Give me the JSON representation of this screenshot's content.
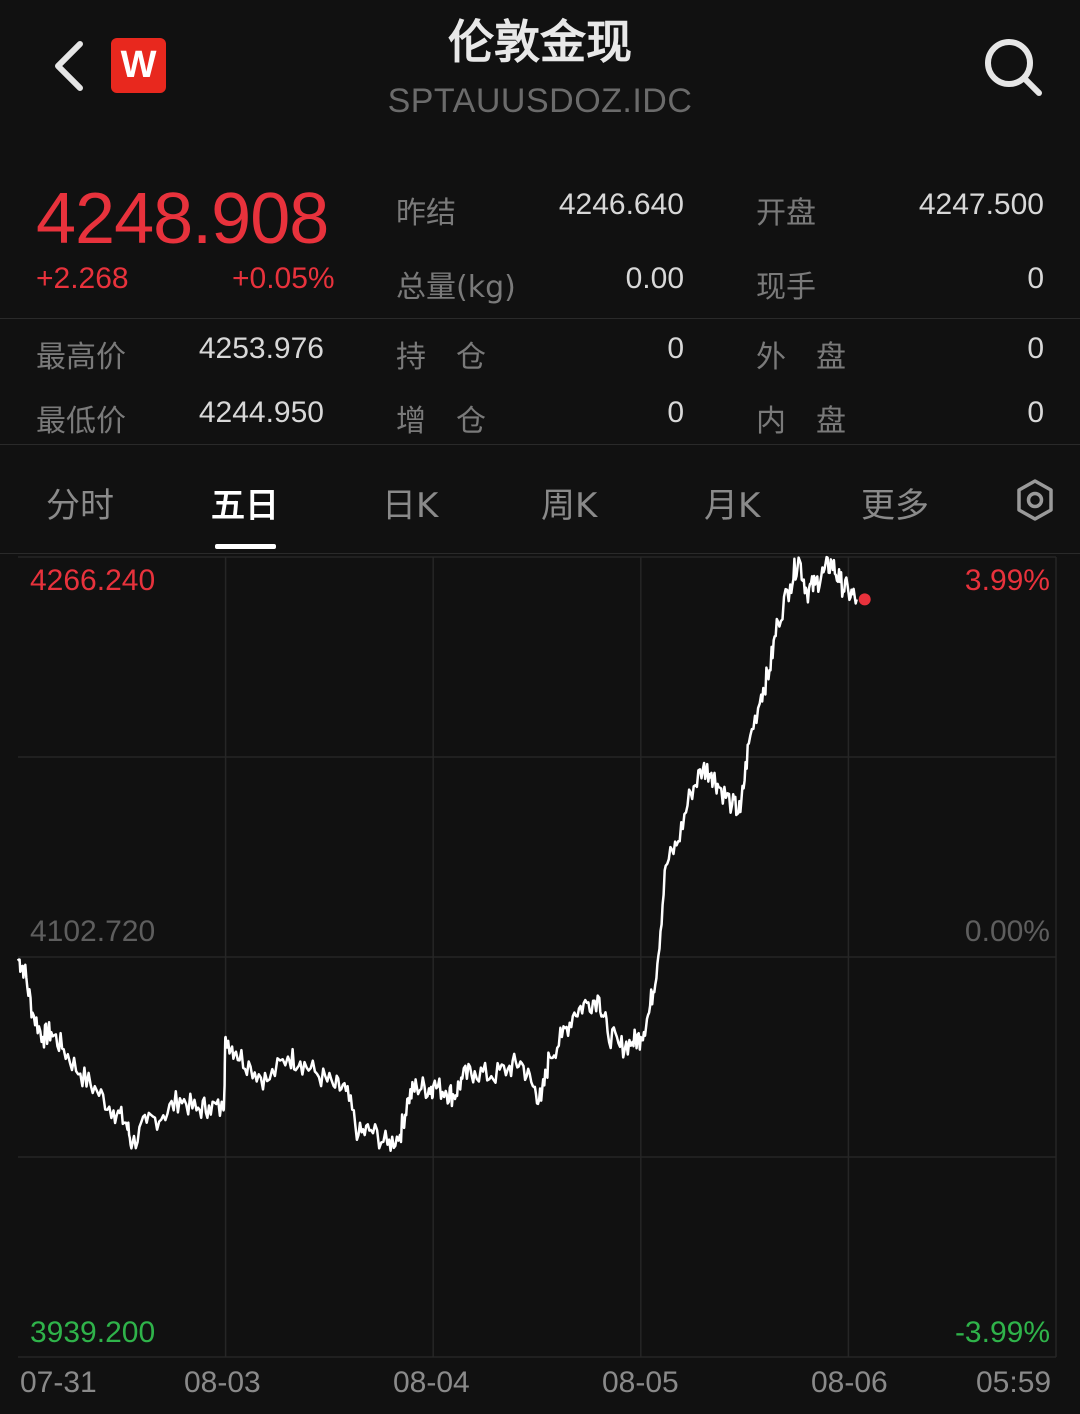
{
  "header": {
    "title": "伦敦金现",
    "symbol": "SPTAUUSDOZ.IDC",
    "logo_letter": "W",
    "back_icon": "chevron-left-icon",
    "search_icon": "search-icon"
  },
  "quote": {
    "price": "4248.908",
    "change": "+2.268",
    "change_pct": "+0.05%",
    "fields": {
      "prev_close_label": "昨结",
      "prev_close": "4246.640",
      "open_label": "开盘",
      "open": "4247.500",
      "volume_label": "总量(kg)",
      "volume": "0.00",
      "current_hand_label": "现手",
      "current_hand": "0",
      "high_label": "最高价",
      "high": "4253.976",
      "position_label": "持　仓",
      "position": "0",
      "outer_label": "外　盘",
      "outer": "0",
      "low_label": "最低价",
      "low": "4244.950",
      "increase_label": "增　仓",
      "increase": "0",
      "inner_label": "内　盘",
      "inner": "0"
    }
  },
  "tabs": [
    {
      "label": "分时",
      "active": false
    },
    {
      "label": "五日",
      "active": true
    },
    {
      "label": "日K",
      "active": false
    },
    {
      "label": "周K",
      "active": false
    },
    {
      "label": "月K",
      "active": false
    },
    {
      "label": "更多",
      "active": false
    }
  ],
  "colors": {
    "up": "#e8323c",
    "down": "#2fb34a",
    "line": "#ffffff",
    "grid": "#262626"
  },
  "chart_data": {
    "type": "line",
    "y_top_label": "4266.240",
    "y_mid_label": "4102.720",
    "y_bottom_label": "3939.200",
    "pct_top_label": "3.99%",
    "pct_mid_label": "0.00%",
    "pct_bottom_label": "-3.99%",
    "ylim": [
      3939.2,
      4266.24
    ],
    "x_labels": [
      "07-31",
      "08-03",
      "08-04",
      "08-05",
      "08-06",
      "05:59"
    ],
    "days": 5,
    "series": [
      {
        "values": [
          [
            0,
            4102
          ],
          [
            0.03,
            4098
          ],
          [
            0.07,
            4080
          ],
          [
            0.12,
            4070
          ],
          [
            0.16,
            4072
          ],
          [
            0.22,
            4065
          ],
          [
            0.3,
            4055
          ],
          [
            0.38,
            4048
          ],
          [
            0.46,
            4040
          ],
          [
            0.52,
            4035
          ],
          [
            0.55,
            4026
          ],
          [
            0.62,
            4035
          ],
          [
            0.7,
            4038
          ],
          [
            0.78,
            4045
          ],
          [
            0.86,
            4040
          ],
          [
            0.92,
            4042
          ],
          [
            0.99,
            4040
          ],
          [
            1.0,
            4070
          ],
          [
            1.05,
            4064
          ],
          [
            1.12,
            4058
          ],
          [
            1.2,
            4052
          ],
          [
            1.3,
            4062
          ],
          [
            1.36,
            4060
          ],
          [
            1.44,
            4055
          ],
          [
            1.52,
            4050
          ],
          [
            1.58,
            4048
          ],
          [
            1.64,
            4030
          ],
          [
            1.7,
            4032
          ],
          [
            1.78,
            4026
          ],
          [
            1.84,
            4030
          ],
          [
            1.88,
            4045
          ],
          [
            1.92,
            4050
          ],
          [
            1.98,
            4049
          ],
          [
            2.0,
            4050
          ],
          [
            2.06,
            4048
          ],
          [
            2.1,
            4046
          ],
          [
            2.14,
            4053
          ],
          [
            2.2,
            4056
          ],
          [
            2.28,
            4054
          ],
          [
            2.36,
            4057
          ],
          [
            2.42,
            4060
          ],
          [
            2.48,
            4050
          ],
          [
            2.52,
            4044
          ],
          [
            2.56,
            4062
          ],
          [
            2.62,
            4070
          ],
          [
            2.68,
            4080
          ],
          [
            2.74,
            4084
          ],
          [
            2.8,
            4086
          ],
          [
            2.84,
            4072
          ],
          [
            2.9,
            4066
          ],
          [
            2.96,
            4068
          ],
          [
            3.0,
            4070
          ],
          [
            3.04,
            4080
          ],
          [
            3.08,
            4100
          ],
          [
            3.12,
            4140
          ],
          [
            3.18,
            4150
          ],
          [
            3.24,
            4170
          ],
          [
            3.3,
            4180
          ],
          [
            3.34,
            4178
          ],
          [
            3.38,
            4172
          ],
          [
            3.44,
            4165
          ],
          [
            3.48,
            4162
          ],
          [
            3.52,
            4190
          ],
          [
            3.58,
            4210
          ],
          [
            3.62,
            4220
          ],
          [
            3.66,
            4240
          ],
          [
            3.72,
            4255
          ],
          [
            3.76,
            4266
          ],
          [
            3.8,
            4252
          ],
          [
            3.84,
            4255
          ],
          [
            3.88,
            4260
          ],
          [
            3.92,
            4264
          ],
          [
            3.96,
            4256
          ],
          [
            4.0,
            4252
          ],
          [
            4.04,
            4248.9
          ]
        ]
      }
    ]
  }
}
